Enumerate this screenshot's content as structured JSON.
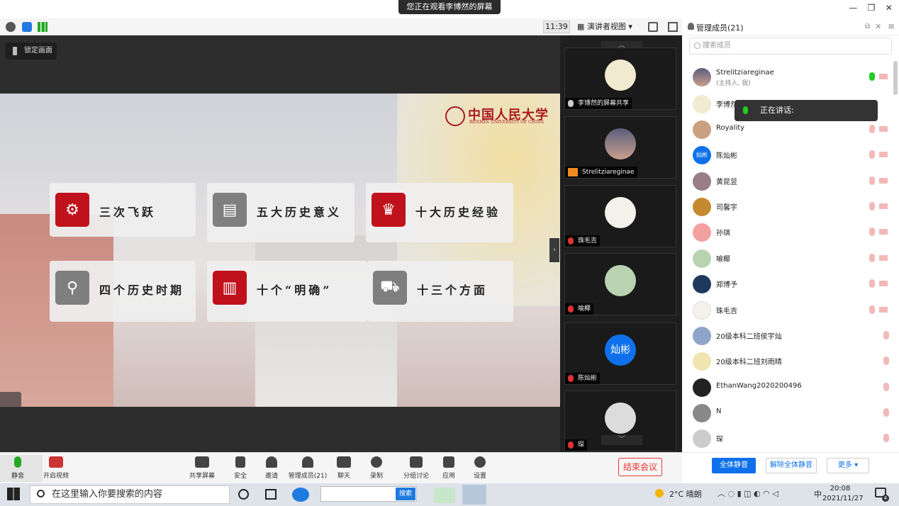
{
  "window": {
    "share_banner": "您正在观看李博然的屏幕",
    "minimize": "—",
    "restore": "❐",
    "close": "✕"
  },
  "toolbar": {
    "time": "11:39",
    "view_mode": "演讲者视图",
    "lock_screen": "锁定画面"
  },
  "slide": {
    "logo_cn": "中国人民大学",
    "logo_en": "RENMIN UNIVERSITY OF CHINA",
    "cards": [
      {
        "label": "三次飞跃",
        "icon": "gear-icon"
      },
      {
        "label": "五大历史意义",
        "icon": "presentation-icon"
      },
      {
        "label": "十大历史经验",
        "icon": "trophy-icon"
      },
      {
        "label": "四个历史时期",
        "icon": "search-icon"
      },
      {
        "label": "十个“明确”",
        "icon": "chart-board-icon"
      },
      {
        "label": "十三个方面",
        "icon": "cart-icon"
      }
    ]
  },
  "video_tiles": [
    {
      "label": "李博然的屏幕共享"
    },
    {
      "label": "Strelitziareginae"
    },
    {
      "label": "珠毛吉"
    },
    {
      "label": "喻椰"
    },
    {
      "label": "陈灿彬",
      "avatar_text": "灿彬"
    },
    {
      "label": "琛"
    }
  ],
  "panel": {
    "title": "管理成员(21)",
    "search_placeholder": "搜索成员",
    "talking": "正在讲话:",
    "members": [
      {
        "name": "Strelitziareginae",
        "sub": "(主持人, 我)"
      },
      {
        "name": "李博然",
        "sub": ""
      },
      {
        "name": "Royality",
        "sub": ""
      },
      {
        "name": "陈灿彬",
        "sub": "",
        "avatar_text": "灿彬"
      },
      {
        "name": "黄昆昱",
        "sub": ""
      },
      {
        "name": "司馨宇",
        "sub": ""
      },
      {
        "name": "孙琪",
        "sub": ""
      },
      {
        "name": "喻椰",
        "sub": ""
      },
      {
        "name": "郑博予",
        "sub": ""
      },
      {
        "name": "珠毛吉",
        "sub": ""
      },
      {
        "name": "20级本科二班侯宇灿",
        "sub": ""
      },
      {
        "name": "20级本科二班刘雨晴",
        "sub": ""
      },
      {
        "name": "EthanWang2020200496",
        "sub": ""
      },
      {
        "name": "N",
        "sub": ""
      },
      {
        "name": "琛",
        "sub": ""
      }
    ],
    "mute_all": "全体静音",
    "unmute_all": "解除全体静音",
    "more": "更多 ▾"
  },
  "bottom": {
    "mute": "静音",
    "video": "开启视频",
    "share": "共享屏幕",
    "security": "安全",
    "invite": "邀请",
    "members": "管理成员(21)",
    "chat": "聊天",
    "record": "录制",
    "breakout": "分组讨论",
    "apps": "应用",
    "settings": "设置",
    "end": "结束会议"
  },
  "taskbar": {
    "search_placeholder": "在这里输入你要搜索的内容",
    "browser_search": "搜索",
    "weather": "2°C 晴朗",
    "ime": "中",
    "time": "20:08",
    "date": "2021/11/27",
    "notifications": "4"
  },
  "colors": {
    "accent": "#0e71eb",
    "slide_red": "#c0121c",
    "end_red": "#e33333"
  }
}
